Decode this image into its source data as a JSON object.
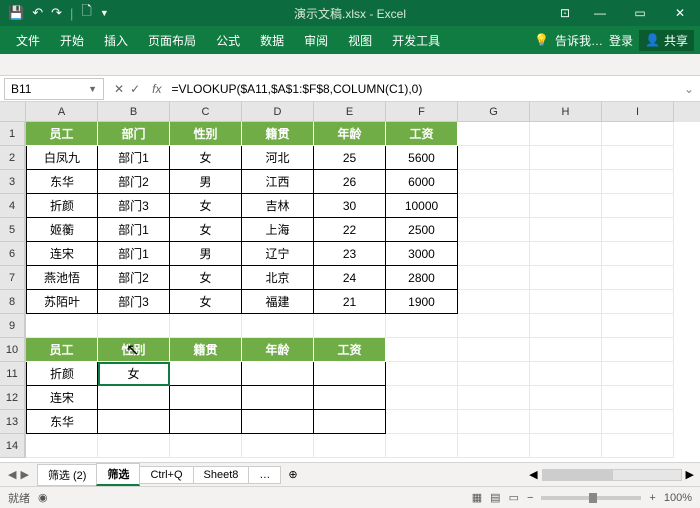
{
  "app": {
    "title": "演示文稿.xlsx - Excel"
  },
  "qat": {
    "save": "💾",
    "undo": "↶",
    "redo": "↷",
    "new": "🗋"
  },
  "winbtns": {
    "min": "—",
    "max": "▭",
    "close": "✕"
  },
  "tabs": {
    "file": "文件",
    "home": "开始",
    "insert": "插入",
    "layout": "页面布局",
    "formula": "公式",
    "data": "数据",
    "review": "审阅",
    "view": "视图",
    "dev": "开发工具",
    "tell": "告诉我…",
    "login": "登录",
    "share": "共享",
    "share_icon": "👤"
  },
  "namebox": {
    "value": "B11"
  },
  "formula": {
    "value": "=VLOOKUP($A11,$A$1:$F$8,COLUMN(C1),0)"
  },
  "fx": {
    "cancel": "✕",
    "enter": "✓",
    "fx": "fx"
  },
  "cols": [
    "A",
    "B",
    "C",
    "D",
    "E",
    "F",
    "G",
    "H",
    "I"
  ],
  "rows": [
    "1",
    "2",
    "3",
    "4",
    "5",
    "6",
    "7",
    "8",
    "9",
    "10",
    "11",
    "12",
    "13",
    "14"
  ],
  "table1": {
    "headers": [
      "员工",
      "部门",
      "性别",
      "籍贯",
      "年龄",
      "工资"
    ],
    "data": [
      [
        "白凤九",
        "部门1",
        "女",
        "河北",
        "25",
        "5600"
      ],
      [
        "东华",
        "部门2",
        "男",
        "江西",
        "26",
        "6000"
      ],
      [
        "折颜",
        "部门3",
        "女",
        "吉林",
        "30",
        "10000"
      ],
      [
        "姬蘅",
        "部门1",
        "女",
        "上海",
        "22",
        "2500"
      ],
      [
        "连宋",
        "部门1",
        "男",
        "辽宁",
        "23",
        "3000"
      ],
      [
        "燕池悟",
        "部门2",
        "女",
        "北京",
        "24",
        "2800"
      ],
      [
        "苏陌叶",
        "部门3",
        "女",
        "福建",
        "21",
        "1900"
      ]
    ]
  },
  "table2": {
    "headers": [
      "员工",
      "性别",
      "籍贯",
      "年龄",
      "工资"
    ],
    "data": [
      [
        "折颜",
        "女",
        "",
        "",
        ""
      ],
      [
        "连宋",
        "",
        "",
        "",
        ""
      ],
      [
        "东华",
        "",
        "",
        "",
        ""
      ]
    ]
  },
  "cursor_cell_text": "性别",
  "sheets": {
    "nav_l": "◀",
    "nav_r": "▶",
    "s1": "筛选 (2)",
    "s2": "筛选",
    "s3": "Ctrl+Q",
    "s4": "Sheet8",
    "more": "…",
    "plus": "⊕"
  },
  "status": {
    "ready": "就绪",
    "rec": "◉",
    "views": {
      "v1": "▦",
      "v2": "▤",
      "v3": "▭"
    },
    "minus": "−",
    "plus": "+",
    "zoom": "100%"
  }
}
